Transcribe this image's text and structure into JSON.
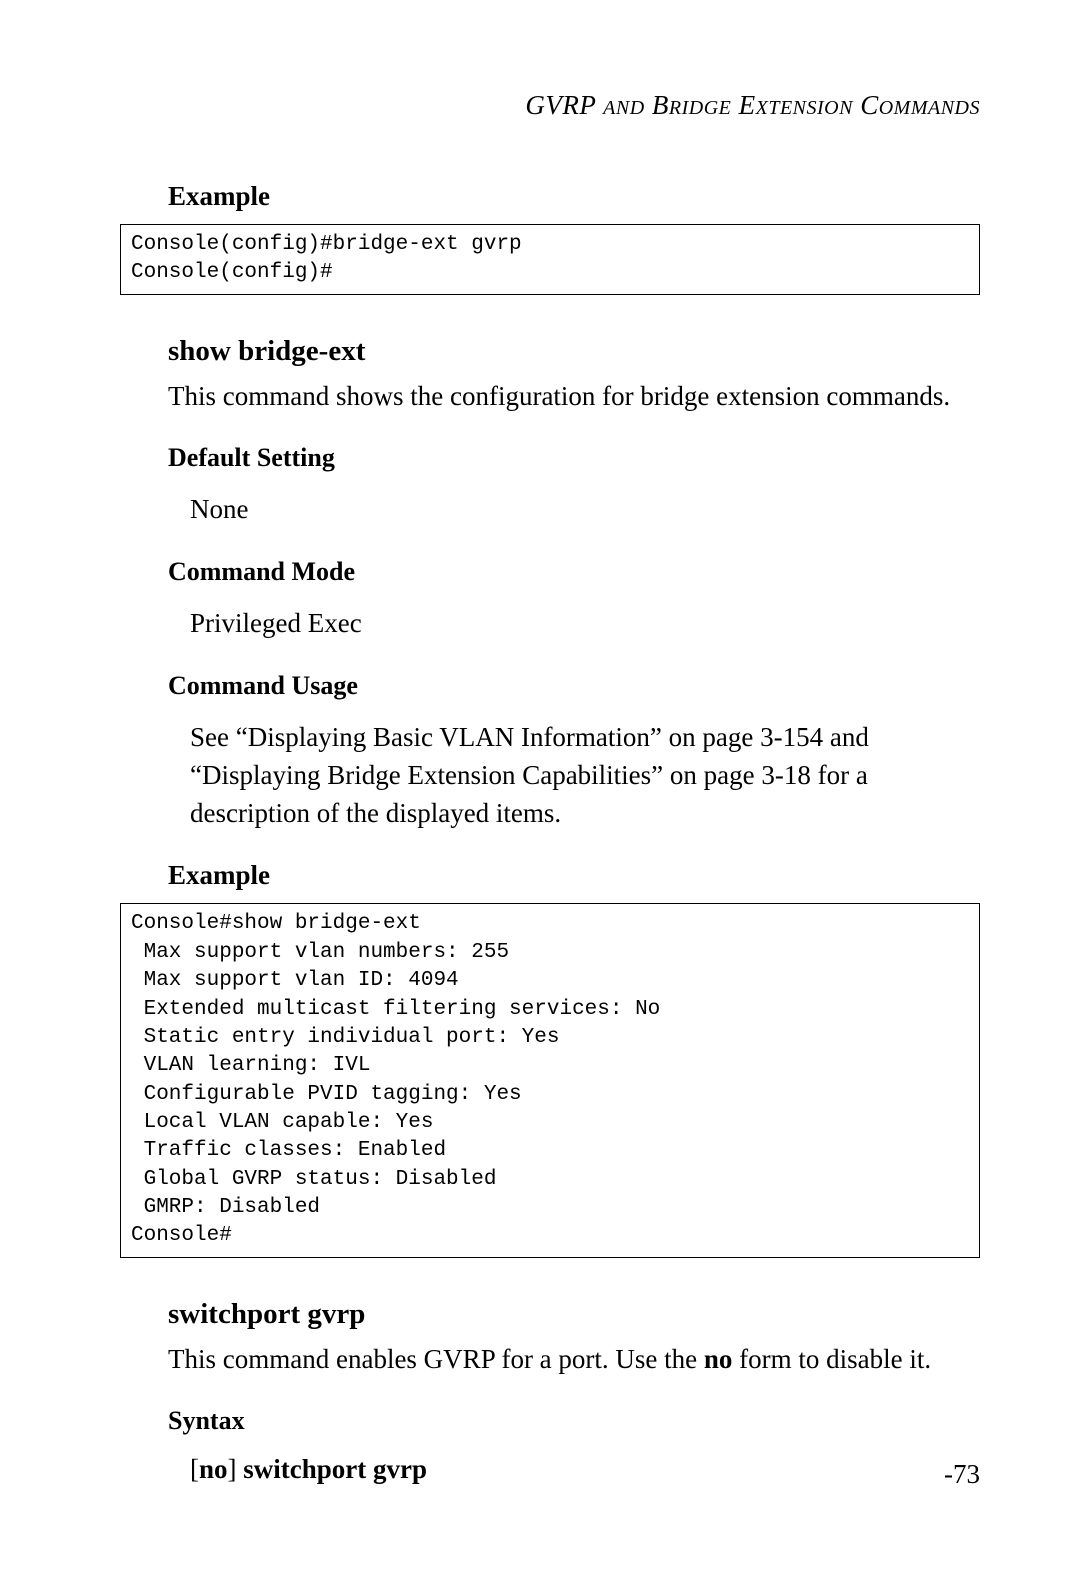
{
  "header": {
    "text": "GVRP AND BRIDGE EXTENSION COMMANDS"
  },
  "sections": {
    "example1_heading": "Example",
    "example1_code": "Console(config)#bridge-ext gvrp\nConsole(config)#",
    "show_bridge_ext": {
      "title": "show bridge-ext",
      "description": "This command shows the configuration for bridge extension commands.",
      "default_setting_heading": "Default Setting",
      "default_setting_value": "None",
      "command_mode_heading": "Command Mode",
      "command_mode_value": "Privileged Exec",
      "command_usage_heading": "Command Usage",
      "command_usage_value": "See “Displaying Basic VLAN Information” on page 3-154 and “Displaying Bridge Extension Capabilities” on page 3-18 for a description of the displayed items.",
      "example_heading": "Example",
      "example_code": "Console#show bridge-ext\n Max support vlan numbers: 255\n Max support vlan ID: 4094\n Extended multicast filtering services: No\n Static entry individual port: Yes\n VLAN learning: IVL\n Configurable PVID tagging: Yes\n Local VLAN capable: Yes\n Traffic classes: Enabled\n Global GVRP status: Disabled\n GMRP: Disabled\nConsole#"
    },
    "switchport_gvrp": {
      "title": "switchport gvrp",
      "description_pre": "This command enables GVRP for a port. Use the ",
      "description_bold": "no",
      "description_post": " form to disable it.",
      "syntax_heading": "Syntax",
      "syntax_prefix": "[",
      "syntax_no": "no",
      "syntax_mid": "] ",
      "syntax_cmd": "switchport gvrp"
    }
  },
  "page_number": "-73"
}
